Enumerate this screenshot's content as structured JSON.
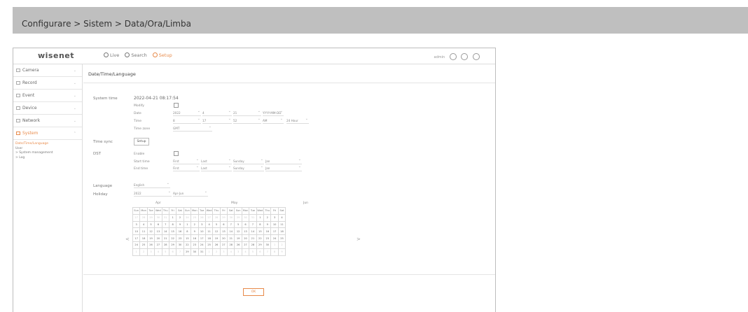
{
  "banner": {
    "breadcrumb": "Configurare > Sistem > Data/Ora/Limba"
  },
  "topbar": {
    "logo": "wisenet",
    "tabs": [
      {
        "label": "Live",
        "icon": "monitor-icon"
      },
      {
        "label": "Search",
        "icon": "search-icon"
      },
      {
        "label": "Setup",
        "icon": "gear-icon"
      }
    ],
    "user": "admin"
  },
  "sidebar": {
    "items": [
      {
        "label": "Camera",
        "icon": "camera-icon"
      },
      {
        "label": "Record",
        "icon": "record-icon"
      },
      {
        "label": "Event",
        "icon": "bell-icon"
      },
      {
        "label": "Device",
        "icon": "device-icon"
      },
      {
        "label": "Network",
        "icon": "network-icon"
      },
      {
        "label": "System",
        "icon": "system-icon"
      }
    ],
    "sub_items": [
      "Date/Time/Language",
      "User",
      "> System management",
      "> Log"
    ]
  },
  "content": {
    "title": "Date/Time/Language",
    "system_time": {
      "label": "System time",
      "value": "2022-04-21 08:17:54",
      "modify_label": "Modify",
      "date_label": "Date",
      "date_values": [
        "2022",
        "4",
        "21",
        "YYYY-MM-DD"
      ],
      "time_label": "Time",
      "time_values": [
        "8",
        "17",
        "52",
        "AM",
        "24 Hour"
      ],
      "timezone_label": "Time zone",
      "timezone_value": "GMT"
    },
    "time_sync": {
      "label": "Time sync",
      "button": "Setup"
    },
    "dst": {
      "label": "DST",
      "enable_label": "Enable",
      "start_label": "Start time",
      "start_values": [
        "First",
        "Last",
        "Sunday",
        "Jan"
      ],
      "end_label": "End time",
      "end_values": [
        "First",
        "Last",
        "Sunday",
        "Jan"
      ]
    },
    "language": {
      "label": "Language",
      "value": "English"
    },
    "holiday": {
      "label": "Holiday",
      "year": "2022",
      "month": "Apr-Jun"
    },
    "calendar": {
      "months": [
        "Apr",
        "May",
        "Jun"
      ],
      "weekdays": [
        "Sun",
        "Mon",
        "Tue",
        "Wed",
        "Thu",
        "Fri",
        "Sat"
      ],
      "rows": [
        [
          [
            "27",
            "28",
            "29",
            "30",
            "31",
            "1",
            "2"
          ],
          [
            "24",
            "25",
            "26",
            "27",
            "28",
            "29",
            "30"
          ],
          [
            "29",
            "30",
            "31",
            "1",
            "2",
            "3",
            "4"
          ]
        ],
        [
          [
            "3",
            "4",
            "5",
            "6",
            "7",
            "8",
            "9"
          ],
          [
            "1",
            "2",
            "3",
            "4",
            "5",
            "6",
            "7"
          ],
          [
            "5",
            "6",
            "7",
            "8",
            "9",
            "10",
            "11"
          ]
        ],
        [
          [
            "10",
            "11",
            "12",
            "13",
            "14",
            "15",
            "16"
          ],
          [
            "8",
            "9",
            "10",
            "11",
            "12",
            "13",
            "14"
          ],
          [
            "12",
            "13",
            "14",
            "15",
            "16",
            "17",
            "18"
          ]
        ],
        [
          [
            "17",
            "18",
            "19",
            "20",
            "21",
            "22",
            "23"
          ],
          [
            "15",
            "16",
            "17",
            "18",
            "19",
            "20",
            "21"
          ],
          [
            "19",
            "20",
            "21",
            "22",
            "23",
            "24",
            "25"
          ]
        ],
        [
          [
            "24",
            "25",
            "26",
            "27",
            "28",
            "29",
            "30"
          ],
          [
            "22",
            "23",
            "24",
            "25",
            "26",
            "27",
            "28"
          ],
          [
            "26",
            "27",
            "28",
            "29",
            "30",
            "1",
            "2"
          ]
        ],
        [
          [
            "1",
            "2",
            "3",
            "4",
            "5",
            "6",
            "7"
          ],
          [
            "29",
            "30",
            "31",
            "1",
            "2",
            "3",
            "4"
          ],
          [
            "3",
            "4",
            "5",
            "6",
            "7",
            "8",
            "9"
          ]
        ]
      ],
      "dim": [
        [
          [
            1,
            1,
            1,
            1,
            1,
            0,
            0
          ],
          [
            1,
            1,
            1,
            1,
            1,
            1,
            1
          ],
          [
            1,
            1,
            1,
            0,
            0,
            0,
            0
          ]
        ],
        [
          [
            0,
            0,
            0,
            0,
            0,
            0,
            0
          ],
          [
            0,
            0,
            0,
            0,
            0,
            0,
            0
          ],
          [
            0,
            0,
            0,
            0,
            0,
            0,
            0
          ]
        ],
        [
          [
            0,
            0,
            0,
            0,
            0,
            0,
            0
          ],
          [
            0,
            0,
            0,
            0,
            0,
            0,
            0
          ],
          [
            0,
            0,
            0,
            0,
            0,
            0,
            0
          ]
        ],
        [
          [
            0,
            0,
            0,
            0,
            0,
            0,
            0
          ],
          [
            0,
            0,
            0,
            0,
            0,
            0,
            0
          ],
          [
            0,
            0,
            0,
            0,
            0,
            0,
            0
          ]
        ],
        [
          [
            0,
            0,
            0,
            0,
            0,
            0,
            0
          ],
          [
            0,
            0,
            0,
            0,
            0,
            0,
            0
          ],
          [
            0,
            0,
            0,
            0,
            0,
            1,
            1
          ]
        ],
        [
          [
            1,
            1,
            1,
            1,
            1,
            1,
            1
          ],
          [
            0,
            0,
            0,
            1,
            1,
            1,
            1
          ],
          [
            1,
            1,
            1,
            1,
            1,
            1,
            1
          ]
        ]
      ],
      "prev": "<",
      "next": ">"
    },
    "ok_button": "OK"
  }
}
